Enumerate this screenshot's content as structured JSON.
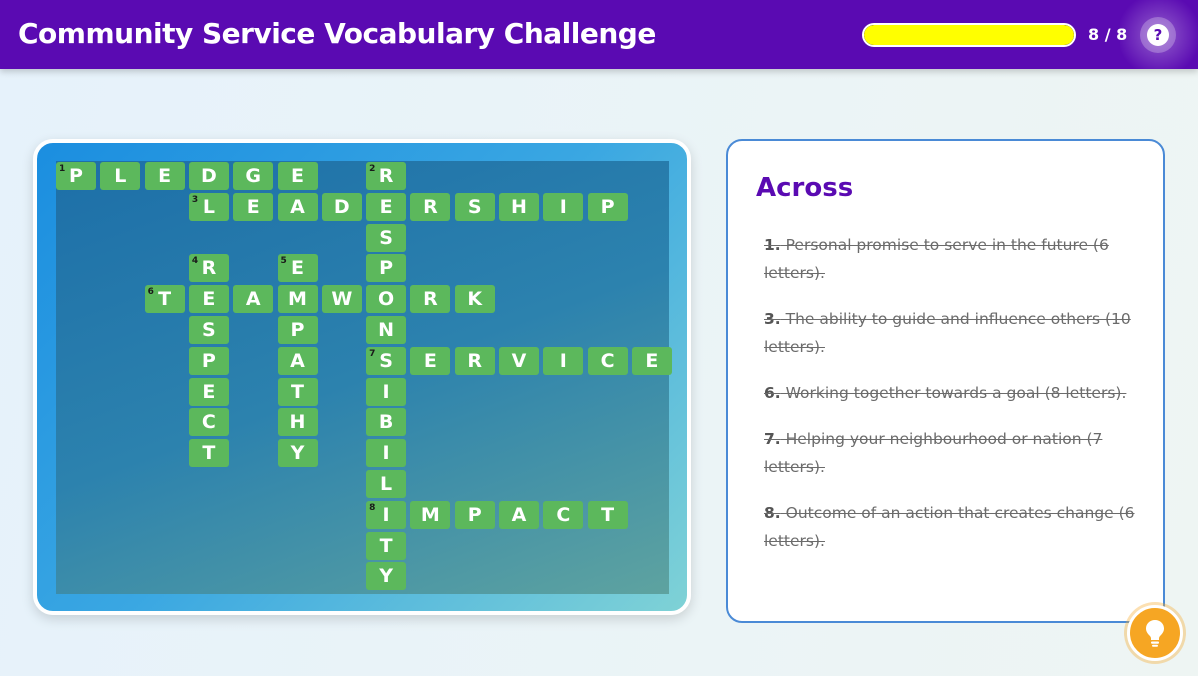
{
  "header": {
    "title": "Community Service Vocabulary Challenge",
    "progress_fraction": 1.0,
    "counter": "8 / 8",
    "help_label": "?",
    "help_icon": "question-icon"
  },
  "crossword": {
    "cells": [
      {
        "letter": "P",
        "num": "1",
        "row": 0,
        "col": 0
      },
      {
        "letter": "L",
        "num": "",
        "row": 0,
        "col": 1
      },
      {
        "letter": "E",
        "num": "",
        "row": 0,
        "col": 2
      },
      {
        "letter": "D",
        "num": "",
        "row": 0,
        "col": 3
      },
      {
        "letter": "G",
        "num": "",
        "row": 0,
        "col": 4
      },
      {
        "letter": "E",
        "num": "",
        "row": 0,
        "col": 5
      },
      {
        "letter": "R",
        "num": "2",
        "row": 0,
        "col": 7
      },
      {
        "letter": "L",
        "num": "3",
        "row": 1,
        "col": 3
      },
      {
        "letter": "E",
        "num": "",
        "row": 1,
        "col": 4
      },
      {
        "letter": "A",
        "num": "",
        "row": 1,
        "col": 5
      },
      {
        "letter": "D",
        "num": "",
        "row": 1,
        "col": 6
      },
      {
        "letter": "E",
        "num": "",
        "row": 1,
        "col": 7
      },
      {
        "letter": "R",
        "num": "",
        "row": 1,
        "col": 8
      },
      {
        "letter": "S",
        "num": "",
        "row": 1,
        "col": 9
      },
      {
        "letter": "H",
        "num": "",
        "row": 1,
        "col": 10
      },
      {
        "letter": "I",
        "num": "",
        "row": 1,
        "col": 11
      },
      {
        "letter": "P",
        "num": "",
        "row": 1,
        "col": 12
      },
      {
        "letter": "S",
        "num": "",
        "row": 2,
        "col": 7
      },
      {
        "letter": "R",
        "num": "4",
        "row": 3,
        "col": 3
      },
      {
        "letter": "E",
        "num": "5",
        "row": 3,
        "col": 5
      },
      {
        "letter": "P",
        "num": "",
        "row": 3,
        "col": 7
      },
      {
        "letter": "T",
        "num": "6",
        "row": 4,
        "col": 2
      },
      {
        "letter": "E",
        "num": "",
        "row": 4,
        "col": 3
      },
      {
        "letter": "A",
        "num": "",
        "row": 4,
        "col": 4
      },
      {
        "letter": "M",
        "num": "",
        "row": 4,
        "col": 5
      },
      {
        "letter": "W",
        "num": "",
        "row": 4,
        "col": 6
      },
      {
        "letter": "O",
        "num": "",
        "row": 4,
        "col": 7
      },
      {
        "letter": "R",
        "num": "",
        "row": 4,
        "col": 8
      },
      {
        "letter": "K",
        "num": "",
        "row": 4,
        "col": 9
      },
      {
        "letter": "S",
        "num": "",
        "row": 5,
        "col": 3
      },
      {
        "letter": "P",
        "num": "",
        "row": 5,
        "col": 5
      },
      {
        "letter": "N",
        "num": "",
        "row": 5,
        "col": 7
      },
      {
        "letter": "P",
        "num": "",
        "row": 6,
        "col": 3
      },
      {
        "letter": "A",
        "num": "",
        "row": 6,
        "col": 5
      },
      {
        "letter": "S",
        "num": "7",
        "row": 6,
        "col": 7
      },
      {
        "letter": "E",
        "num": "",
        "row": 6,
        "col": 8
      },
      {
        "letter": "R",
        "num": "",
        "row": 6,
        "col": 9
      },
      {
        "letter": "V",
        "num": "",
        "row": 6,
        "col": 10
      },
      {
        "letter": "I",
        "num": "",
        "row": 6,
        "col": 11
      },
      {
        "letter": "C",
        "num": "",
        "row": 6,
        "col": 12
      },
      {
        "letter": "E",
        "num": "",
        "row": 6,
        "col": 13
      },
      {
        "letter": "E",
        "num": "",
        "row": 7,
        "col": 3
      },
      {
        "letter": "T",
        "num": "",
        "row": 7,
        "col": 5
      },
      {
        "letter": "I",
        "num": "",
        "row": 7,
        "col": 7
      },
      {
        "letter": "C",
        "num": "",
        "row": 8,
        "col": 3
      },
      {
        "letter": "H",
        "num": "",
        "row": 8,
        "col": 5
      },
      {
        "letter": "B",
        "num": "",
        "row": 8,
        "col": 7
      },
      {
        "letter": "T",
        "num": "",
        "row": 9,
        "col": 3
      },
      {
        "letter": "Y",
        "num": "",
        "row": 9,
        "col": 5
      },
      {
        "letter": "I",
        "num": "",
        "row": 9,
        "col": 7
      },
      {
        "letter": "L",
        "num": "",
        "row": 10,
        "col": 7
      },
      {
        "letter": "I",
        "num": "8",
        "row": 11,
        "col": 7
      },
      {
        "letter": "M",
        "num": "",
        "row": 11,
        "col": 8
      },
      {
        "letter": "P",
        "num": "",
        "row": 11,
        "col": 9
      },
      {
        "letter": "A",
        "num": "",
        "row": 11,
        "col": 10
      },
      {
        "letter": "C",
        "num": "",
        "row": 11,
        "col": 11
      },
      {
        "letter": "T",
        "num": "",
        "row": 11,
        "col": 12
      },
      {
        "letter": "T",
        "num": "",
        "row": 12,
        "col": 7
      },
      {
        "letter": "Y",
        "num": "",
        "row": 13,
        "col": 7
      }
    ]
  },
  "clues": {
    "heading": "Across",
    "items": [
      {
        "num": "1.",
        "text": " Personal promise to serve in the future (6 letters)."
      },
      {
        "num": "3.",
        "text": " The ability to guide and influence others (10 letters)."
      },
      {
        "num": "6.",
        "text": " Working together towards a goal (8 letters)."
      },
      {
        "num": "7.",
        "text": " Helping your neighbourhood or nation (7 letters)."
      },
      {
        "num": "8.",
        "text": " Outcome of an action that creates change (6 letters)."
      }
    ]
  },
  "hint": {
    "icon": "lightbulb-icon"
  },
  "colors": {
    "header": "#5a0ab2",
    "progress": "#ffff00",
    "cell": "#5cb85c",
    "hint": "#f6a623"
  }
}
